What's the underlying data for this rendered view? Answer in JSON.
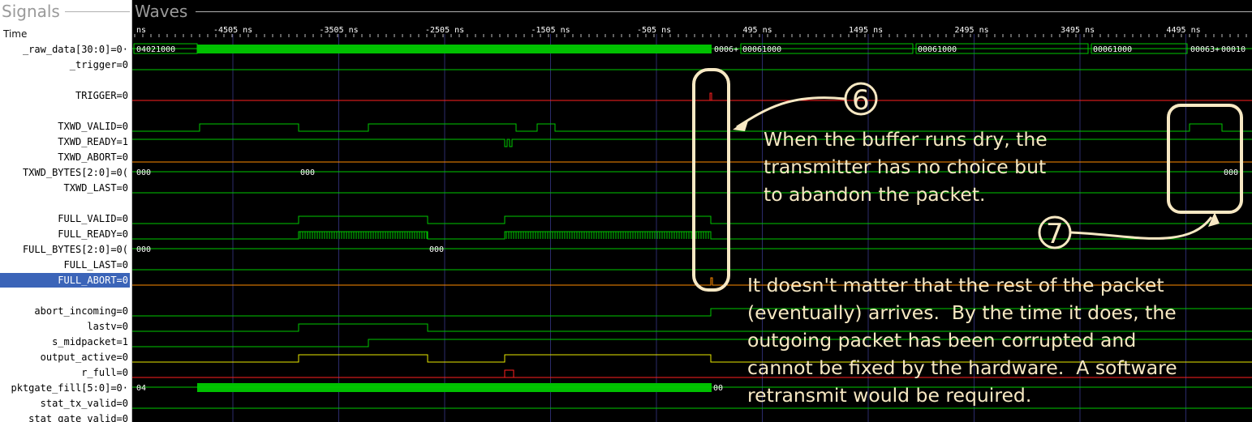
{
  "panes": {
    "signals_title": "Signals",
    "waves_title": "Waves",
    "time_label": "Time"
  },
  "colors": {
    "wave_green": "#00c800",
    "bus_fill": "#00c000",
    "trigger_red": "#ff2020",
    "abort_orange": "#ff8c00",
    "yellow": "#e8e800",
    "annotation": "#f7e8c3",
    "selected_row": "#3b64b8"
  },
  "ruler": {
    "unit_label": "ns",
    "ticks": [
      {
        "label": "-4505 ns",
        "t": -4505
      },
      {
        "label": "-3505 ns",
        "t": -3505
      },
      {
        "label": "-2505 ns",
        "t": -2505
      },
      {
        "label": "-1505 ns",
        "t": -1505
      },
      {
        "label": "-505 ns",
        "t": -505
      },
      {
        "label": "495 ns",
        "t": 495
      },
      {
        "label": "1495 ns",
        "t": 1495
      },
      {
        "label": "2495 ns",
        "t": 2495
      },
      {
        "label": "3495 ns",
        "t": 3495
      },
      {
        "label": "4495 ns",
        "t": 4495
      }
    ]
  },
  "signals": [
    {
      "name": "_raw_data[30:0]",
      "value": "=0·"
    },
    {
      "name": "_trigger",
      "value": "=0"
    },
    {
      "name": "",
      "value": ""
    },
    {
      "name": "TRIGGER",
      "value": "=0"
    },
    {
      "name": "",
      "value": ""
    },
    {
      "name": "TXWD_VALID",
      "value": "=0"
    },
    {
      "name": "TXWD_READY",
      "value": "=1"
    },
    {
      "name": "TXWD_ABORT",
      "value": "=0"
    },
    {
      "name": "TXWD_BYTES[2:0]",
      "value": "=0("
    },
    {
      "name": "TXWD_LAST",
      "value": "=0"
    },
    {
      "name": "",
      "value": ""
    },
    {
      "name": "FULL_VALID",
      "value": "=0"
    },
    {
      "name": "FULL_READY",
      "value": "=0"
    },
    {
      "name": "FULL_BYTES[2:0]",
      "value": "=0("
    },
    {
      "name": "FULL_LAST",
      "value": "=0"
    },
    {
      "name": "FULL_ABORT",
      "value": "=0",
      "selected": true
    },
    {
      "name": "",
      "value": ""
    },
    {
      "name": "abort_incoming",
      "value": "=0"
    },
    {
      "name": "lastv",
      "value": "=0"
    },
    {
      "name": "s_midpacket",
      "value": "=1"
    },
    {
      "name": "output_active",
      "value": "=0"
    },
    {
      "name": "r_full",
      "value": "=0"
    },
    {
      "name": "pktgate_fill[5:0]",
      "value": "=0·"
    },
    {
      "name": "stat_tx_valid",
      "value": "=0"
    },
    {
      "name": "stat_gate_valid",
      "value": "=0"
    }
  ],
  "bus_values": {
    "raw_data": [
      "04021000",
      "0006+",
      "00061000",
      "00061000",
      "00061000",
      "00063+",
      "00010"
    ],
    "txwd_bytes": [
      "000",
      "000",
      "000"
    ],
    "full_bytes": [
      "000",
      "000"
    ],
    "pktgate_fill": [
      "04",
      "00"
    ]
  },
  "callouts": {
    "six": {
      "number": "6",
      "text": "When the buffer runs dry, the\ntransmitter has no choice but\nto abandon the packet."
    },
    "seven": {
      "number": "7"
    },
    "bottom": {
      "text": "It doesn't matter that the rest of the packet\n(eventually) arrives.  By the time it does, the\noutgoing packet has been corrupted and\ncannot be fixed by the hardware.  A software\nretransmit would be required."
    }
  }
}
